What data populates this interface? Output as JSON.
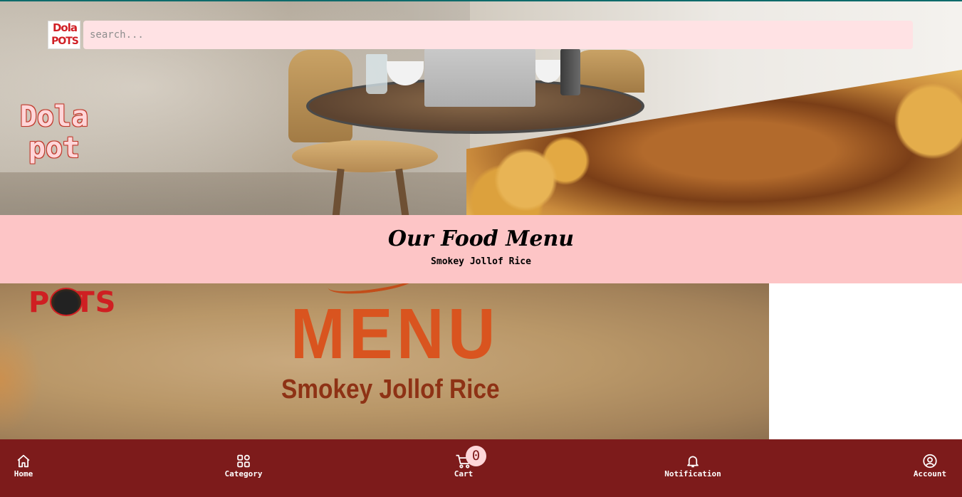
{
  "brand": {
    "logo_line1": "Dola",
    "logo_line2": "POTS",
    "hero_title": "Dola pot"
  },
  "search": {
    "placeholder": "search...",
    "value": ""
  },
  "menu_section": {
    "title": "Our Food Menu",
    "subtitle": "Smokey Jollof Rice"
  },
  "menu_image": {
    "brand_text": "POTS",
    "heading": "MENU",
    "dish": "Smokey Jollof Rice"
  },
  "bottom_nav": {
    "items": [
      {
        "label": "Home",
        "icon": "home-icon"
      },
      {
        "label": "Category",
        "icon": "grid-icon"
      },
      {
        "label": "Cart",
        "icon": "cart-icon"
      },
      {
        "label": "Notification",
        "icon": "bell-icon"
      },
      {
        "label": "Account",
        "icon": "user-circle-icon"
      }
    ],
    "cart_count": "0"
  },
  "colors": {
    "nav_bg": "#7d1b1b",
    "menu_header_bg": "#fdc5c6",
    "search_bg": "#ffe2e4",
    "brand_red": "#d01f25"
  }
}
